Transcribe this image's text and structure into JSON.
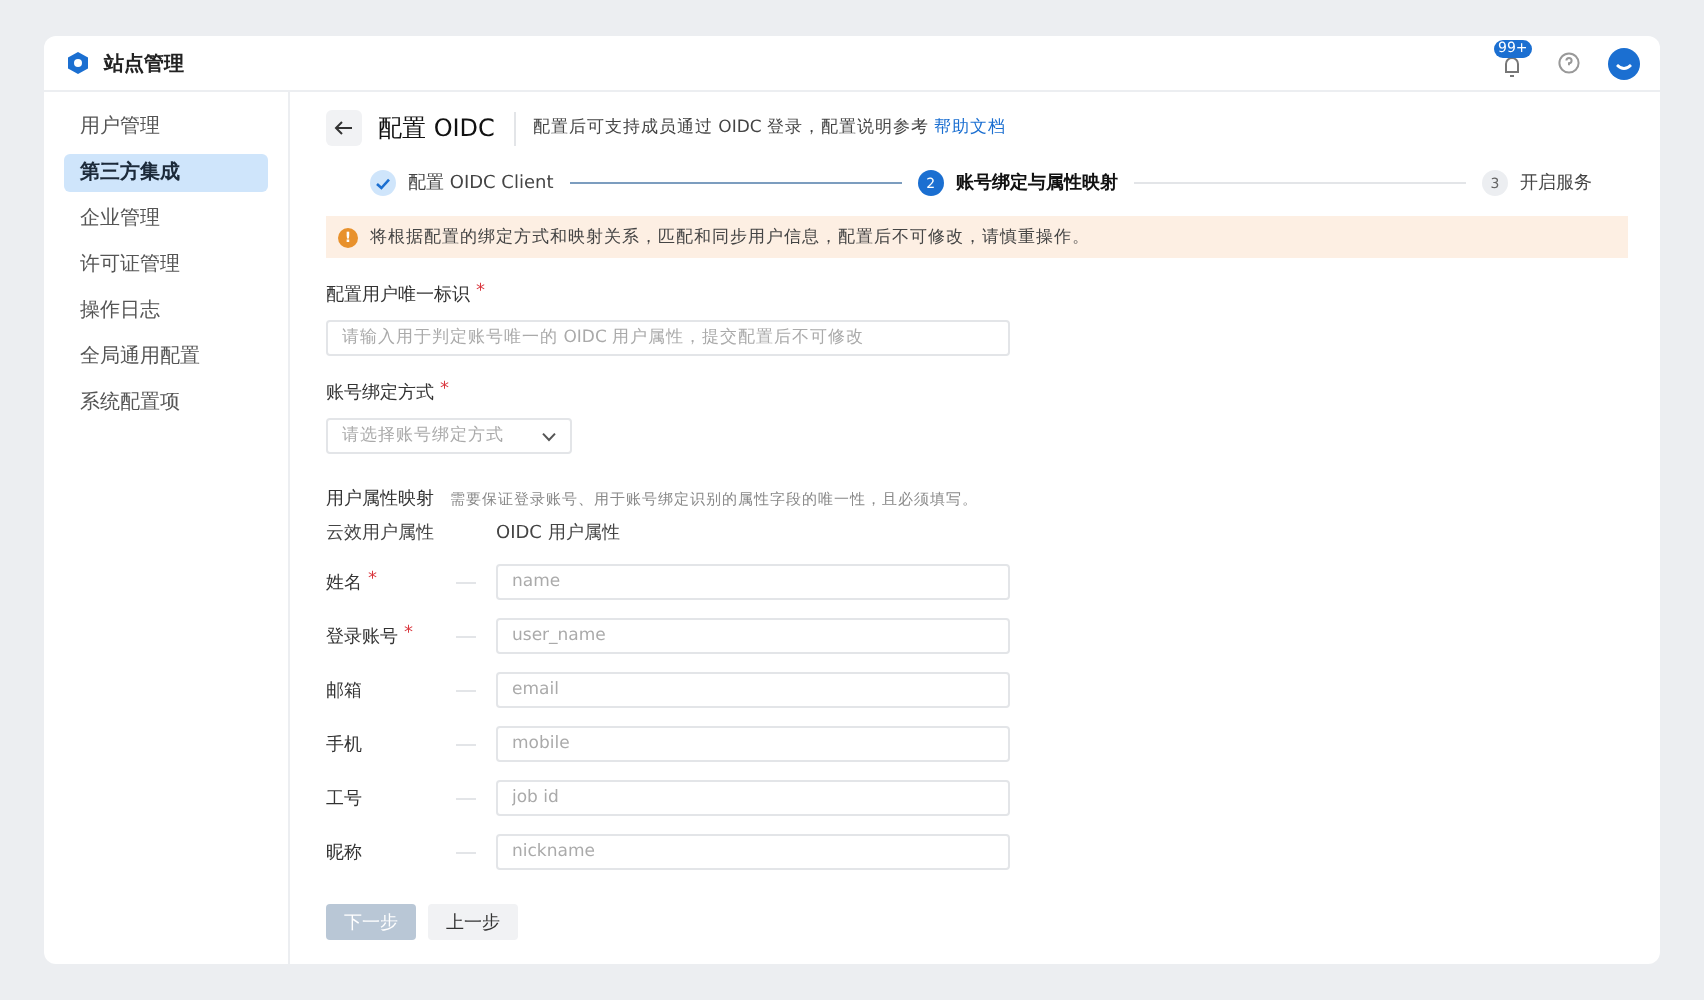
{
  "header": {
    "title": "站点管理",
    "badge": "99+"
  },
  "sidebar": {
    "items": [
      {
        "label": "用户管理",
        "selected": false
      },
      {
        "label": "第三方集成",
        "selected": true
      },
      {
        "label": "企业管理",
        "selected": false
      },
      {
        "label": "许可证管理",
        "selected": false
      },
      {
        "label": "操作日志",
        "selected": false
      },
      {
        "label": "全局通用配置",
        "selected": false
      },
      {
        "label": "系统配置项",
        "selected": false
      }
    ]
  },
  "page": {
    "title": "配置 OIDC",
    "description": "配置后可支持成员通过 OIDC 登录，配置说明参考",
    "link": "帮助文档"
  },
  "steps": [
    {
      "done": true,
      "selected": false,
      "label": "配置 OIDC Client"
    },
    {
      "done": false,
      "selected": true,
      "number": "2",
      "label": "账号绑定与属性映射"
    },
    {
      "done": false,
      "selected": false,
      "number": "3",
      "label": "开启服务"
    }
  ],
  "alert": {
    "icon": "!",
    "text": "将根据配置的绑定方式和映射关系，匹配和同步用户信息，配置后不可修改，请慎重操作。"
  },
  "unique_id": {
    "label": "配置用户唯一标识",
    "mark": "*",
    "placeholder": "请输入用于判定账号唯一的 OIDC 用户属性，提交配置后不可修改"
  },
  "bind_mode": {
    "label": "账号绑定方式",
    "mark": "*",
    "placeholder": "请选择账号绑定方式"
  },
  "mapping": {
    "title": "用户属性映射",
    "hint": "需要保证登录账号、用于账号绑定识别的属性字段的唯一性，且必须填写。",
    "column_1": "云效用户属性",
    "column_2": "OIDC 用户属性",
    "rows": [
      {
        "label": "姓名",
        "mark": "*",
        "placeholder": "name"
      },
      {
        "label": "登录账号",
        "mark": "*",
        "placeholder": "user_name"
      },
      {
        "label": "邮箱",
        "placeholder": "email"
      },
      {
        "label": "手机",
        "placeholder": "mobile"
      },
      {
        "label": "工号",
        "placeholder": "job id"
      },
      {
        "label": "昵称",
        "placeholder": "nickname"
      }
    ]
  },
  "buttons": [
    {
      "label": "下一步",
      "kind": "primary",
      "disabled": true
    },
    {
      "label": "上一步",
      "kind": "secondary",
      "disabled": false
    }
  ]
}
